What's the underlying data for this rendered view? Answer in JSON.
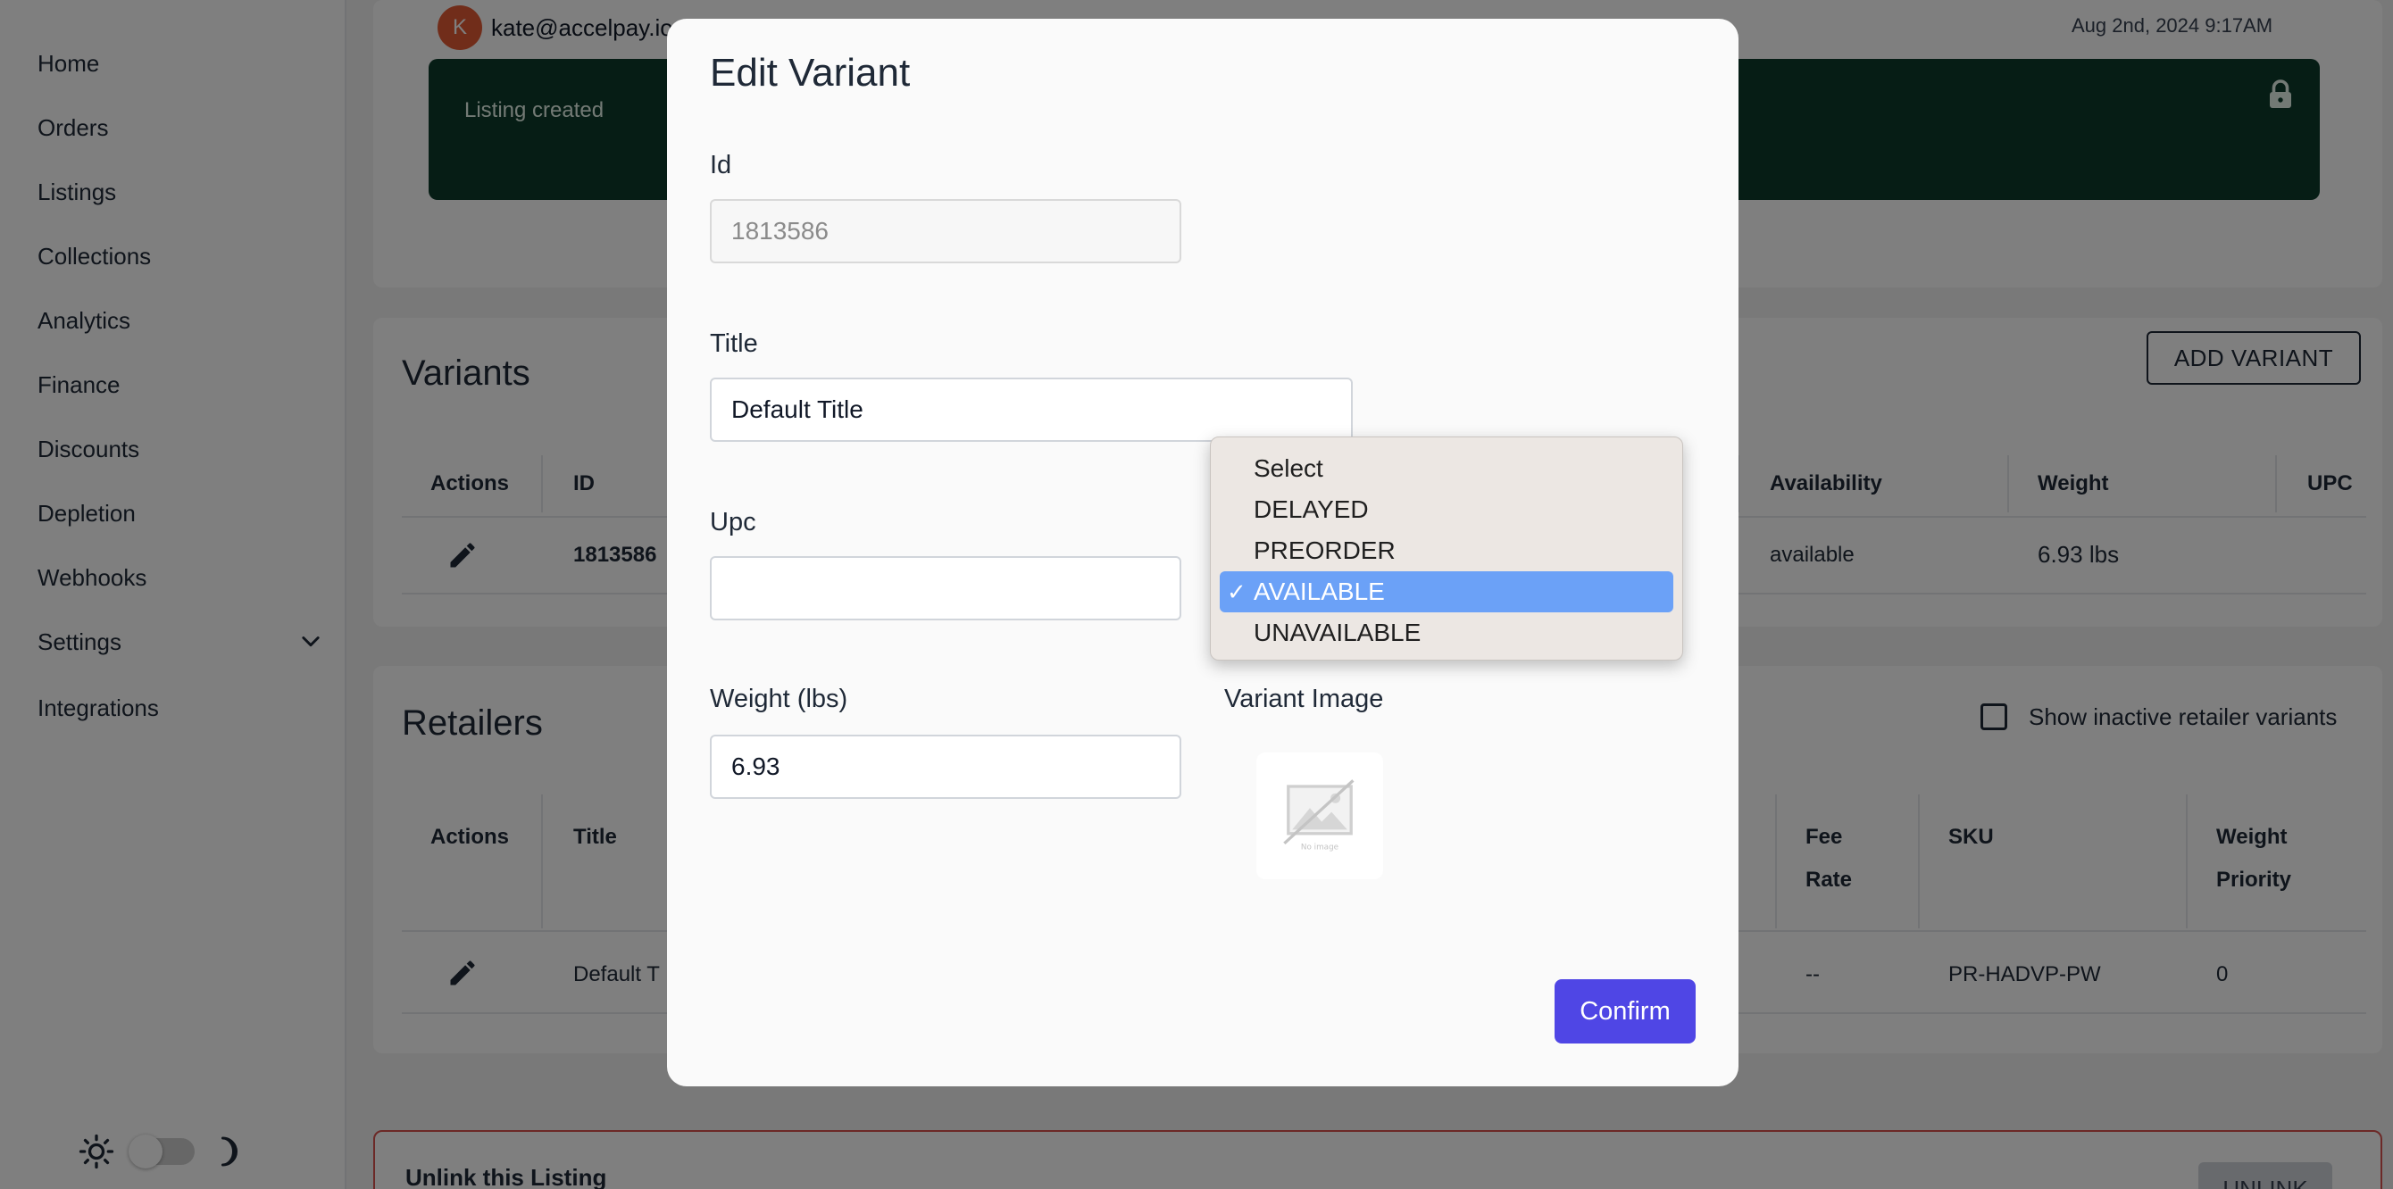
{
  "sidebar": {
    "items": [
      {
        "label": "Home"
      },
      {
        "label": "Orders"
      },
      {
        "label": "Listings"
      },
      {
        "label": "Collections"
      },
      {
        "label": "Analytics"
      },
      {
        "label": "Finance"
      },
      {
        "label": "Discounts"
      },
      {
        "label": "Depletion"
      },
      {
        "label": "Webhooks"
      },
      {
        "label": "Settings"
      },
      {
        "label": "Integrations"
      }
    ]
  },
  "header": {
    "avatar_initial": "K",
    "email": "kate@accelpay.io",
    "timestamp": "Aug 2nd, 2024 9:17AM",
    "banner_text": "Listing created"
  },
  "variants": {
    "title": "Variants",
    "add_button": "ADD VARIANT",
    "columns": [
      "Actions",
      "ID",
      "Availability",
      "Weight",
      "UPC"
    ],
    "row": {
      "id": "1813586",
      "availability": "available",
      "weight": "6.93 lbs"
    }
  },
  "retailers": {
    "title": "Retailers",
    "show_inactive_label": "Show inactive retailer variants",
    "columns": [
      "Actions",
      "Title",
      "Fee Rate",
      "SKU",
      "Weight Priority"
    ],
    "row": {
      "title": "Default T",
      "fee_rate": "--",
      "sku": "PR-HADVP-PW",
      "weight_priority": "0"
    }
  },
  "danger": {
    "title": "Unlink this Listing",
    "button": "UNLINK"
  },
  "modal": {
    "title": "Edit Variant",
    "id_label": "Id",
    "id_placeholder": "1813586",
    "title_label": "Title",
    "title_value": "Default Title",
    "upc_label": "Upc",
    "upc_value": "",
    "weight_label": "Weight (lbs)",
    "weight_value": "6.93",
    "image_label": "Variant Image",
    "image_placeholder_text": "No image",
    "confirm": "Confirm"
  },
  "availability_dropdown": {
    "options": [
      "Select",
      "DELAYED",
      "PREORDER",
      "AVAILABLE",
      "UNAVAILABLE"
    ],
    "selected": "AVAILABLE",
    "check_glyph": "✓"
  },
  "colors": {
    "accent": "#4f46e5",
    "banner": "#0d3b2a",
    "selected_option": "#6ba1f7",
    "avatar": "#e25b35",
    "danger": "#d9534f"
  }
}
